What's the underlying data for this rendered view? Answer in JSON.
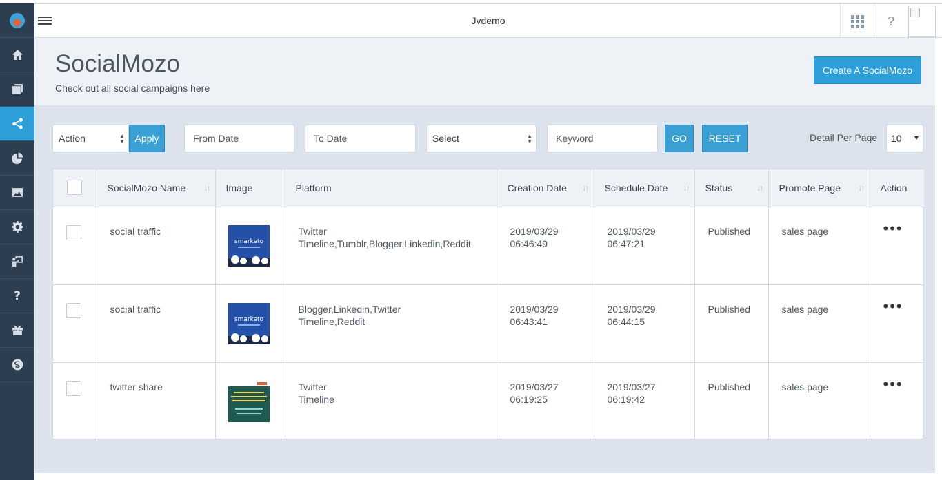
{
  "app": {
    "title": "Jvdemo"
  },
  "sidebar": {
    "items": [
      {
        "name": "home-icon",
        "active": false
      },
      {
        "name": "pages-icon",
        "active": false
      },
      {
        "name": "share-icon",
        "active": true
      },
      {
        "name": "pie-chart-icon",
        "active": false
      },
      {
        "name": "image-icon",
        "active": false
      },
      {
        "name": "gear-icon",
        "active": false
      },
      {
        "name": "presenter-icon",
        "active": false
      },
      {
        "name": "question-icon",
        "active": false
      },
      {
        "name": "gift-icon",
        "active": false
      },
      {
        "name": "skype-icon",
        "active": false
      }
    ]
  },
  "page": {
    "title": "SocialMozo",
    "subtitle": "Check out all social campaigns here",
    "create_button": "Create A SocialMozo"
  },
  "filters": {
    "action_select": "Action",
    "apply": "Apply",
    "from_date": "From Date",
    "to_date": "To Date",
    "select": "Select",
    "keyword": "Keyword",
    "go": "GO",
    "reset": "RESET",
    "per_page_label": "Detail Per Page",
    "per_page_value": "10"
  },
  "table": {
    "headers": {
      "name": "SocialMozo Name",
      "image": "Image",
      "platform": "Platform",
      "creation": "Creation Date",
      "schedule": "Schedule Date",
      "status": "Status",
      "promote": "Promote Page",
      "action": "Action"
    },
    "rows": [
      {
        "name": "social traffic",
        "platform_line1": "Twitter",
        "platform_line2": "Timeline,Tumblr,Blogger,Linkedin,Reddit",
        "creation_date": "2019/03/29",
        "creation_time": "06:46:49",
        "schedule_date": "2019/03/29",
        "schedule_time": "06:47:21",
        "status": "Published",
        "promote": "sales page",
        "thumb": "smarketo",
        "action_icon": "•••"
      },
      {
        "name": "social traffic",
        "platform_line1": "Blogger,Linkedin,Twitter",
        "platform_line2": "Timeline,Reddit",
        "creation_date": "2019/03/29",
        "creation_time": "06:43:41",
        "schedule_date": "2019/03/29",
        "schedule_time": "06:44:15",
        "status": "Published",
        "promote": "sales page",
        "thumb": "smarketo",
        "action_icon": "•••"
      },
      {
        "name": "twitter share",
        "platform_line1": "Twitter",
        "platform_line2": "Timeline",
        "creation_date": "2019/03/27",
        "creation_time": "06:19:25",
        "schedule_date": "2019/03/27",
        "schedule_time": "06:19:42",
        "status": "Published",
        "promote": "sales page",
        "thumb": "",
        "action_icon": "•••"
      }
    ]
  },
  "colors": {
    "accent": "#2d9fd8",
    "sidebar": "#2c3e50"
  }
}
